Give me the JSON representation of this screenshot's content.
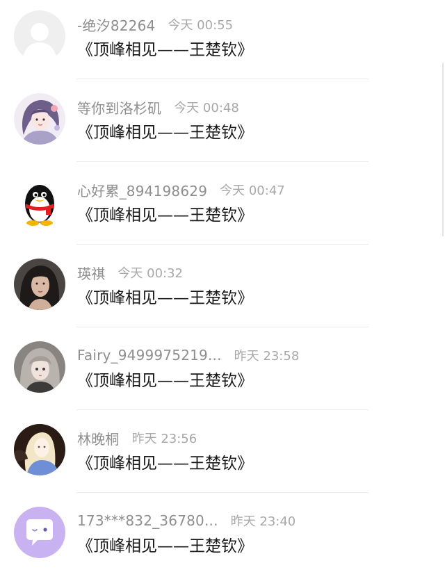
{
  "comments": [
    {
      "name": "-绝汐82264",
      "time": "今天 00:55",
      "text": "《顶峰相见——王楚钦》",
      "avatar_icon": "default-user-icon"
    },
    {
      "name": "等你到洛杉矶",
      "time": "今天 00:48",
      "text": "《顶峰相见——王楚钦》",
      "avatar_icon": "illustrated-girl-avatar"
    },
    {
      "name": "心好累_894198629",
      "time": "今天 00:47",
      "text": "《顶峰相见——王楚钦》",
      "avatar_icon": "qq-penguin-icon"
    },
    {
      "name": "瑛祺",
      "time": "今天 00:32",
      "text": "《顶峰相见——王楚钦》",
      "avatar_icon": "portrait-photo-avatar"
    },
    {
      "name": "Fairy_9499975219...",
      "time": "昨天 23:58",
      "text": "《顶峰相见——王楚钦》",
      "avatar_icon": "anime-girl-avatar"
    },
    {
      "name": "林晚桐",
      "time": "昨天 23:56",
      "text": "《顶峰相见——王楚钦》",
      "avatar_icon": "blonde-girl-avatar"
    },
    {
      "name": "173***832_36780...",
      "time": "昨天 23:40",
      "text": "《顶峰相见——王楚钦》",
      "avatar_icon": "purple-chat-bubble-icon"
    }
  ],
  "colors": {
    "name": "#8e8e8e",
    "time": "#a8a8a8",
    "message": "#1a1a1a",
    "divider": "#ececec",
    "chat_avatar_bg": "#c9b2f2"
  }
}
